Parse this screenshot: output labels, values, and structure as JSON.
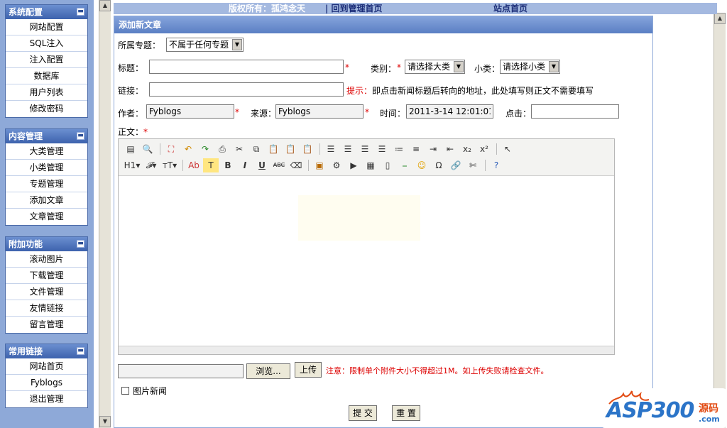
{
  "sidebar": {
    "groups": [
      {
        "title": "系统配置",
        "items": [
          "网站配置",
          "SQL注入",
          "注入配置",
          "数据库",
          "用户列表",
          "修改密码"
        ]
      },
      {
        "title": "内容管理",
        "items": [
          "大类管理",
          "小类管理",
          "专题管理",
          "添加文章",
          "文章管理"
        ]
      },
      {
        "title": "附加功能",
        "items": [
          "滚动图片",
          "下载管理",
          "文件管理",
          "友情链接",
          "留言管理"
        ]
      },
      {
        "title": "常用链接",
        "items": [
          "网站首页",
          "Fyblogs",
          "退出管理"
        ]
      }
    ],
    "toggle_icon": "minus-icon"
  },
  "topbar": {
    "copyright": "版权所有：孤鸿念天",
    "back_admin": "| 回到管理首页",
    "site_home": "站点首页"
  },
  "panel": {
    "title": "添加新文章",
    "special_label": "所属专题：",
    "special_value": "不属于任何专题",
    "title_label": "标题：",
    "title_value": "",
    "required_mark": "*",
    "category_label": "类别：",
    "category_value": "请选择大类",
    "subcategory_label": "小类：",
    "subcategory_value": "请选择小类",
    "link_label": "链接：",
    "link_value": "",
    "hint_label": "提示：",
    "hint_text": "即点击新闻标题后转向的地址，此处填写则正文不需要填写",
    "author_label": "作者：",
    "author_value": "Fyblogs",
    "source_label": "来源：",
    "source_value": "Fyblogs",
    "time_label": "时间：",
    "time_value": "2011-3-14 12:01:01",
    "clicks_label": "点击：",
    "clicks_value": "",
    "body_label": "正文：",
    "browse_button": "浏览...",
    "upload_button": "上传",
    "upload_note": "注意：限制单个附件大小不得超过1M。如上传失败请检查文件。",
    "image_news_label": "图片新闻",
    "image_news_checked": false,
    "submit_button": "提 交",
    "reset_button": "重 置"
  },
  "editor": {
    "toolbar_row1": [
      "source-icon",
      "preview-icon",
      "|",
      "fullscreen-icon",
      "undo-icon",
      "redo-icon",
      "print-icon",
      "cut-icon",
      "copy-icon",
      "paste-icon",
      "paste-text-icon",
      "paste-word-icon",
      "|",
      "align-left-icon",
      "align-center-icon",
      "align-right-icon",
      "justify-icon",
      "ordered-list-icon",
      "unordered-list-icon",
      "indent-icon",
      "outdent-icon",
      "subscript-icon",
      "superscript-icon",
      "|",
      "select-all-icon"
    ],
    "toolbar_row2": [
      "heading-icon",
      "font-family-icon",
      "font-size-icon",
      "|",
      "text-color-icon",
      "highlight-icon",
      "bold-icon",
      "italic-icon",
      "underline-icon",
      "strikethrough-icon",
      "eraser-icon",
      "|",
      "image-icon",
      "flash-icon",
      "media-icon",
      "table-icon",
      "page-break-icon",
      "hr-icon",
      "emoticon-icon",
      "special-char-icon",
      "link-icon",
      "unlink-icon",
      "|",
      "help-icon"
    ]
  },
  "watermark": {
    "brand": "ASP300",
    "cn": "源码",
    "suffix": ".com"
  },
  "colors": {
    "sidebar_bg": "#8ea9d8",
    "header_blue": "#3d62ad",
    "required_red": "#dd0000",
    "watermark_blue": "#2b74c8",
    "watermark_orange": "#e24b13"
  }
}
